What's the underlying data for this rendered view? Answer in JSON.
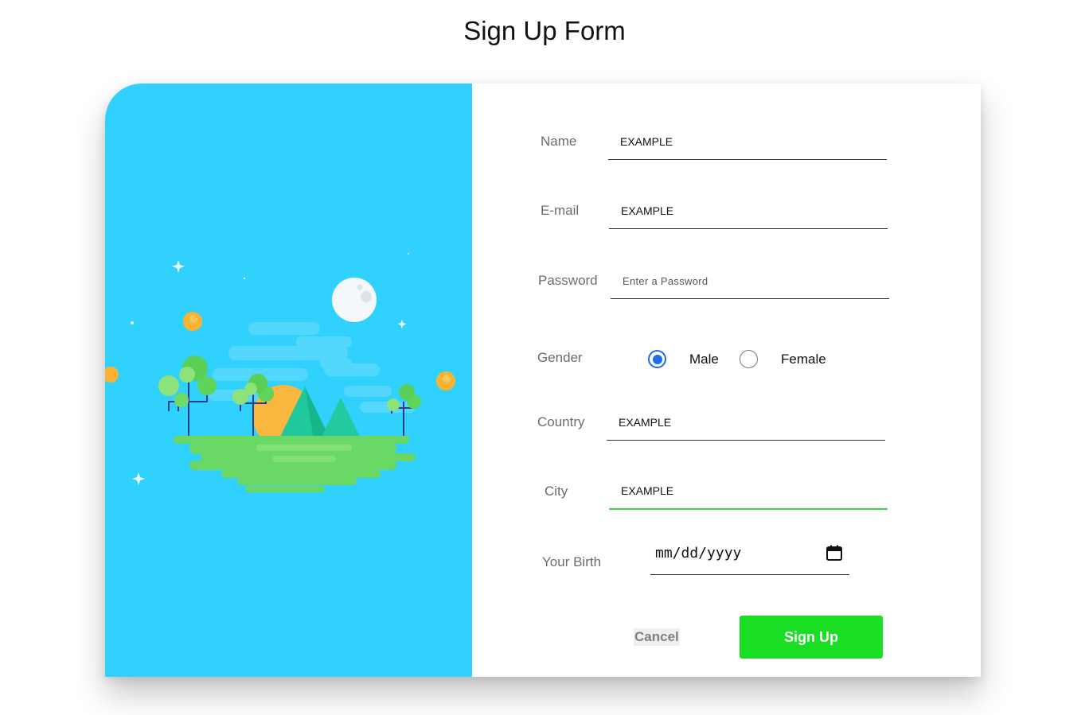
{
  "page": {
    "title": "Sign Up Form"
  },
  "form": {
    "name": {
      "label": "Name",
      "value": "EXAMPLE"
    },
    "email": {
      "label": "E-mail",
      "value": "EXAMPLE"
    },
    "password": {
      "label": "Password",
      "placeholder": "Enter a Password",
      "value": ""
    },
    "gender": {
      "label": "Gender",
      "options": [
        {
          "label": "Male",
          "selected": true
        },
        {
          "label": "Female",
          "selected": false
        }
      ]
    },
    "country": {
      "label": "Country",
      "value": "EXAMPLE"
    },
    "city": {
      "label": "City",
      "value": "EXAMPLE",
      "focused": true
    },
    "birth": {
      "label": "Your Birth",
      "placeholder": "mm/dd/yyyy",
      "icon": "calendar-icon"
    },
    "buttons": {
      "cancel": "Cancel",
      "signup": "Sign Up"
    }
  },
  "colors": {
    "illustration_bg": "#31d1fe",
    "accent_green": "#19de23",
    "focus_underline": "#3ad63a",
    "radio_selected": "#1c6fe8"
  }
}
